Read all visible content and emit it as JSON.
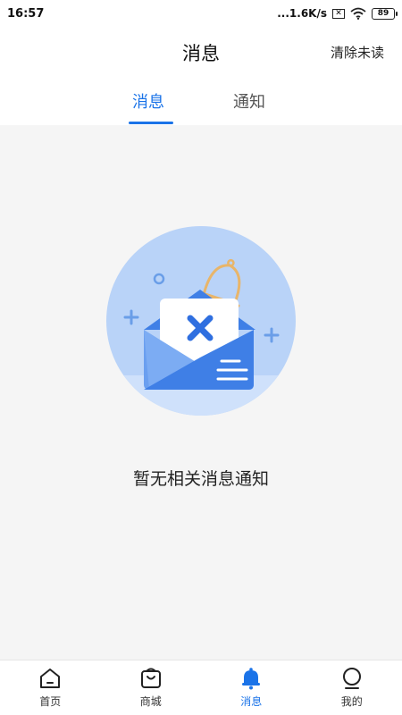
{
  "status_bar": {
    "time": "16:57",
    "network_speed": "...1.6K/s",
    "sim_icon": "x-box-icon",
    "wifi_icon": "wifi-icon",
    "battery_level": "89"
  },
  "header": {
    "title": "消息",
    "clear_unread_label": "清除未读"
  },
  "tabs": [
    {
      "label": "消息",
      "active": true
    },
    {
      "label": "通知",
      "active": false
    }
  ],
  "empty_state": {
    "illustration_icon": "envelope-error-bell-icon",
    "message": "暂无相关消息通知"
  },
  "bottom_nav": [
    {
      "label": "首页",
      "icon": "home-icon",
      "active": false
    },
    {
      "label": "商城",
      "icon": "shopping-bag-icon",
      "active": false
    },
    {
      "label": "消息",
      "icon": "bell-icon",
      "active": true
    },
    {
      "label": "我的",
      "icon": "profile-icon",
      "active": false
    }
  ],
  "colors": {
    "accent": "#1a73e8",
    "background": "#f5f5f5",
    "illustration_circle": "#b9d3f8",
    "envelope_dark": "#3f7fe6"
  }
}
